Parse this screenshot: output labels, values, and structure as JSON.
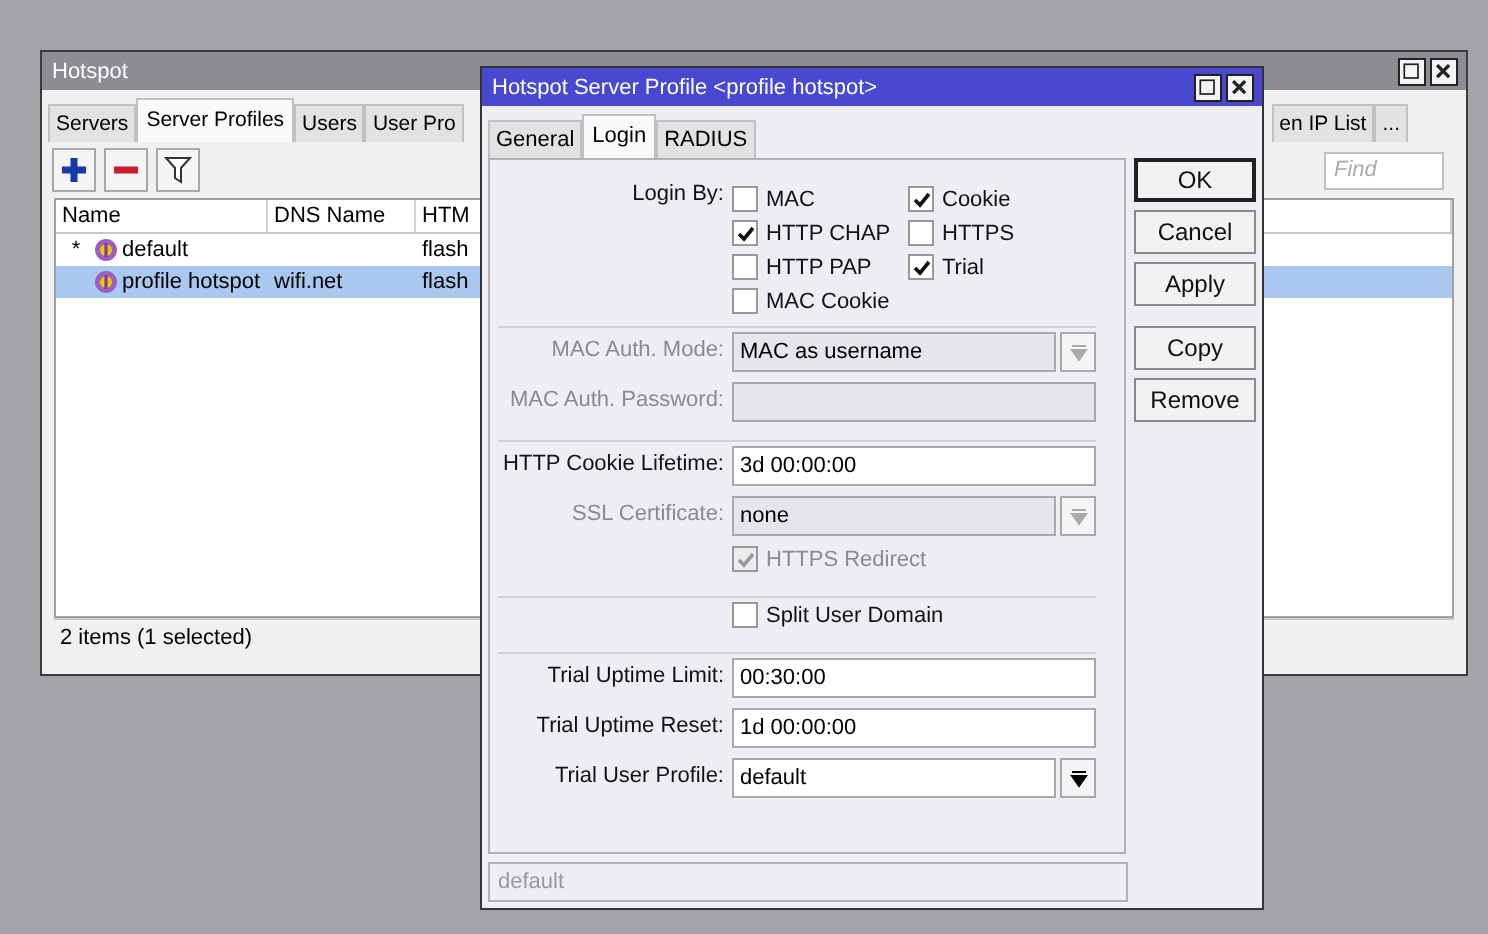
{
  "back_window": {
    "title": "Hotspot",
    "tabs": [
      {
        "label": "Servers",
        "selected": false
      },
      {
        "label": "Server Profiles",
        "selected": true
      },
      {
        "label": "Users",
        "selected": false
      },
      {
        "label": "User Pro",
        "selected": false
      }
    ],
    "right_tabs": [
      {
        "label": "en IP List",
        "selected": false
      },
      {
        "label": "...",
        "selected": false
      }
    ],
    "find": {
      "placeholder": "Find"
    },
    "columns": [
      "Name",
      "DNS Name",
      "HTM"
    ],
    "rows": [
      {
        "marker": "*",
        "name": "default",
        "column_3": "flash",
        "selected": false
      },
      {
        "name": "profile hotspot",
        "dns": "wifi.net",
        "column_3": "flash",
        "selected": true
      }
    ],
    "status": "2 items (1 selected)"
  },
  "dialog": {
    "title": "Hotspot Server Profile <profile hotspot>",
    "tabs": [
      {
        "label": "General",
        "selected": false
      },
      {
        "label": "Login",
        "selected": true
      },
      {
        "label": "RADIUS",
        "selected": false
      }
    ],
    "login_by": {
      "label": "Login By:",
      "options": [
        {
          "label": "MAC",
          "checked": false
        },
        {
          "label": "HTTP CHAP",
          "checked": true
        },
        {
          "label": "HTTP PAP",
          "checked": false
        },
        {
          "label": "MAC Cookie",
          "checked": false
        },
        {
          "label": "Cookie",
          "checked": true
        },
        {
          "label": "HTTPS",
          "checked": false
        },
        {
          "label": "Trial",
          "checked": true
        }
      ]
    },
    "groups": [
      [
        {
          "kind": "select",
          "label": "MAC Auth. Mode:",
          "value": "MAC as username",
          "disabled": true
        },
        {
          "kind": "input",
          "label": "MAC Auth. Password:",
          "disabled": true
        }
      ],
      [
        {
          "kind": "input",
          "label": "HTTP Cookie Lifetime:",
          "value": "3d 00:00:00",
          "disabled": false
        },
        {
          "kind": "select",
          "label": "SSL Certificate:",
          "value": "none",
          "disabled": true
        },
        {
          "kind": "checkbox",
          "label": "HTTPS Redirect",
          "checked": true,
          "disabled": true
        }
      ],
      [
        {
          "kind": "checkbox",
          "label": "Split User Domain",
          "checked": false,
          "disabled": false
        }
      ],
      [
        {
          "kind": "input",
          "label": "Trial Uptime Limit:",
          "value": "00:30:00",
          "disabled": false
        },
        {
          "kind": "input",
          "label": "Trial Uptime Reset:",
          "value": "1d 00:00:00",
          "disabled": false
        },
        {
          "kind": "select",
          "label": "Trial User Profile:",
          "value": "default",
          "disabled": false
        }
      ]
    ],
    "buttons": [
      [
        "OK",
        "Cancel",
        "Apply"
      ],
      [
        "Copy",
        "Remove"
      ]
    ],
    "status": "default"
  }
}
